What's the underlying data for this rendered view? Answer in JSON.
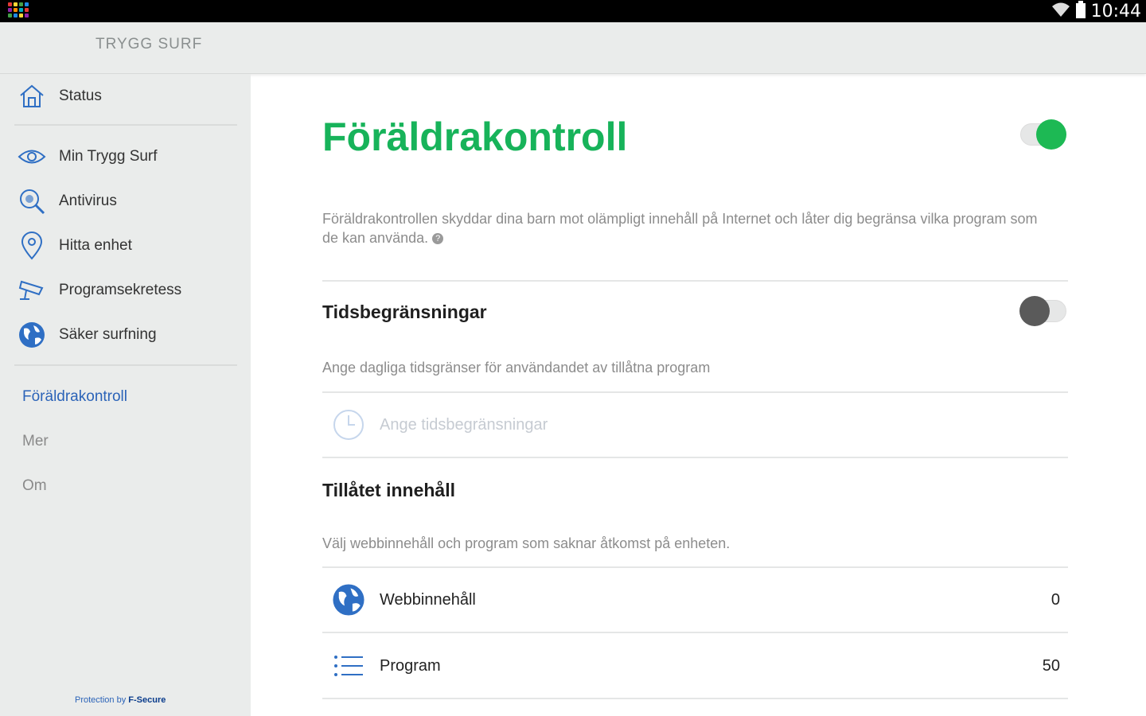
{
  "status_bar": {
    "time": "10:44"
  },
  "app": {
    "title": "TRYGG SURF"
  },
  "sidebar": {
    "items": [
      {
        "label": "Status",
        "icon": "house-icon"
      },
      {
        "label": "Min Trygg Surf",
        "icon": "eye-shield-icon"
      },
      {
        "label": "Antivirus",
        "icon": "magnifier-icon"
      },
      {
        "label": "Hitta enhet",
        "icon": "location-pin-icon"
      },
      {
        "label": "Programsekretess",
        "icon": "camera-icon"
      },
      {
        "label": "Säker surfning",
        "icon": "globe-icon"
      }
    ],
    "secondary": [
      {
        "label": "Föräldrakontroll",
        "active": true
      },
      {
        "label": "Mer",
        "active": false
      },
      {
        "label": "Om",
        "active": false
      }
    ],
    "footer": {
      "prefix": "Protection by",
      "brand": "F-Secure"
    }
  },
  "main": {
    "title": "Föräldrakontroll",
    "enabled": true,
    "description": "Föräldrakontrollen skyddar dina barn mot olämpligt innehåll på Internet och låter dig begränsa vilka program som de kan använda.",
    "time_limits": {
      "title": "Tidsbegränsningar",
      "enabled": false,
      "description": "Ange dagliga tidsgränser för användandet av tillåtna program",
      "action_label": "Ange tidsbegränsningar"
    },
    "allowed_content": {
      "title": "Tillåtet innehåll",
      "description": "Välj webbinnehåll och program som saknar åtkomst på enheten.",
      "rows": [
        {
          "label": "Webbinnehåll",
          "count": "0",
          "icon": "globe-icon"
        },
        {
          "label": "Program",
          "count": "50",
          "icon": "list-icon"
        }
      ]
    }
  },
  "colors": {
    "accent_green": "#17b35a",
    "link_blue": "#2b63b8",
    "icon_blue": "#2f6fc4"
  }
}
